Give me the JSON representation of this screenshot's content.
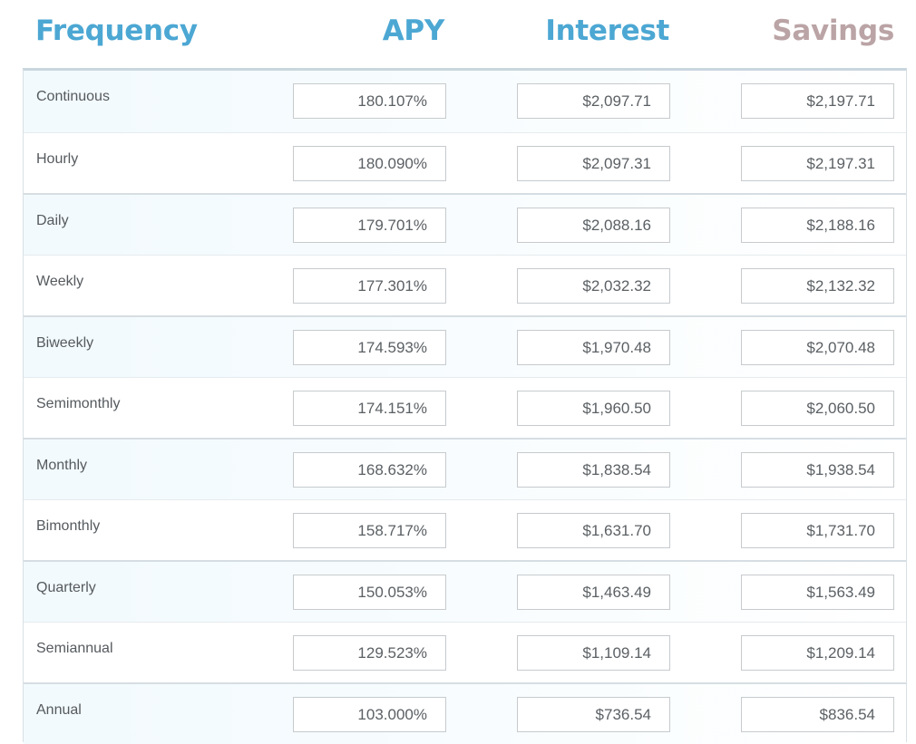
{
  "headers": {
    "frequency": "Frequency",
    "apy": "APY",
    "interest": "Interest",
    "savings": "Savings"
  },
  "colors": {
    "header_blue": "#4ca7d3",
    "header_savings": "#bba4a6"
  },
  "rows": [
    {
      "frequency": "Continuous",
      "apy": "180.107%",
      "interest": "$2,097.71",
      "savings": "$2,197.71"
    },
    {
      "frequency": "Hourly",
      "apy": "180.090%",
      "interest": "$2,097.31",
      "savings": "$2,197.31"
    },
    {
      "frequency": "Daily",
      "apy": "179.701%",
      "interest": "$2,088.16",
      "savings": "$2,188.16"
    },
    {
      "frequency": "Weekly",
      "apy": "177.301%",
      "interest": "$2,032.32",
      "savings": "$2,132.32"
    },
    {
      "frequency": "Biweekly",
      "apy": "174.593%",
      "interest": "$1,970.48",
      "savings": "$2,070.48"
    },
    {
      "frequency": "Semimonthly",
      "apy": "174.151%",
      "interest": "$1,960.50",
      "savings": "$2,060.50"
    },
    {
      "frequency": "Monthly",
      "apy": "168.632%",
      "interest": "$1,838.54",
      "savings": "$1,938.54"
    },
    {
      "frequency": "Bimonthly",
      "apy": "158.717%",
      "interest": "$1,631.70",
      "savings": "$1,731.70"
    },
    {
      "frequency": "Quarterly",
      "apy": "150.053%",
      "interest": "$1,463.49",
      "savings": "$1,563.49"
    },
    {
      "frequency": "Semiannual",
      "apy": "129.523%",
      "interest": "$1,109.14",
      "savings": "$1,209.14"
    },
    {
      "frequency": "Annual",
      "apy": "103.000%",
      "interest": "$736.54",
      "savings": "$836.54"
    }
  ]
}
